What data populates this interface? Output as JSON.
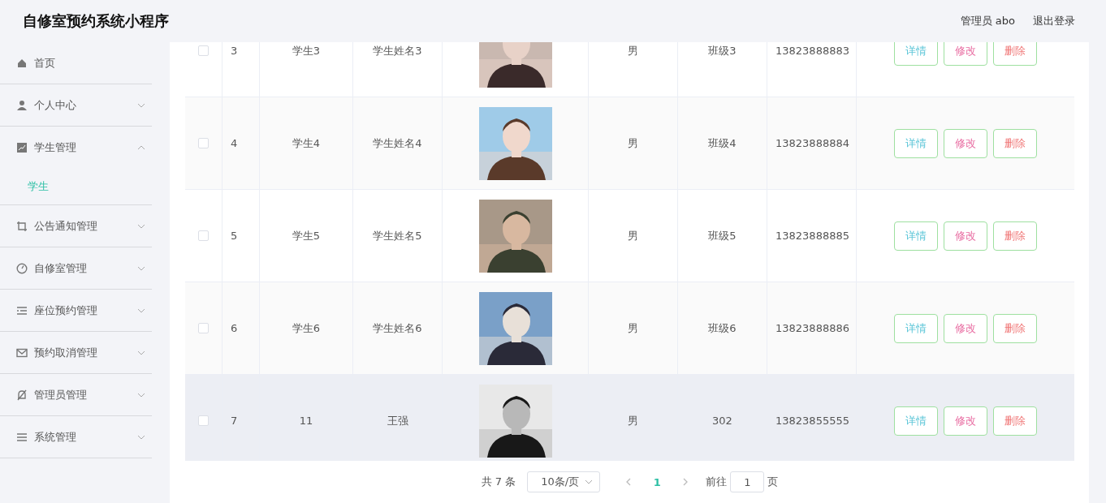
{
  "header": {
    "title": "自修室预约系统小程序",
    "user": "管理员 abo",
    "logout": "退出登录"
  },
  "sidebar": {
    "items": [
      {
        "label": "首页"
      },
      {
        "label": "个人中心",
        "expanded": false
      },
      {
        "label": "学生管理",
        "expanded": true,
        "children": [
          {
            "label": "学生",
            "selected": true
          }
        ]
      },
      {
        "label": "公告通知管理",
        "expanded": false
      },
      {
        "label": "自修室管理",
        "expanded": false
      },
      {
        "label": "座位预约管理",
        "expanded": false
      },
      {
        "label": "预约取消管理",
        "expanded": false
      },
      {
        "label": "管理员管理",
        "expanded": false
      },
      {
        "label": "系统管理",
        "expanded": false
      }
    ]
  },
  "table": {
    "rows": [
      {
        "index": "3",
        "student_no": "学生3",
        "name": "学生姓名3",
        "gender": "男",
        "class": "班级3",
        "phone": "13823888883",
        "checked": false,
        "highlighted": false,
        "actions": [
          "详情",
          "修改",
          "删除"
        ]
      },
      {
        "index": "4",
        "student_no": "学生4",
        "name": "学生姓名4",
        "gender": "男",
        "class": "班级4",
        "phone": "13823888884",
        "checked": false,
        "highlighted": false,
        "actions": [
          "详情",
          "修改",
          "删除"
        ]
      },
      {
        "index": "5",
        "student_no": "学生5",
        "name": "学生姓名5",
        "gender": "男",
        "class": "班级5",
        "phone": "13823888885",
        "checked": false,
        "highlighted": false,
        "actions": [
          "详情",
          "修改",
          "删除"
        ]
      },
      {
        "index": "6",
        "student_no": "学生6",
        "name": "学生姓名6",
        "gender": "男",
        "class": "班级6",
        "phone": "13823888886",
        "checked": false,
        "highlighted": false,
        "actions": [
          "详情",
          "修改",
          "删除"
        ]
      },
      {
        "index": "7",
        "student_no": "11",
        "name": "王强",
        "gender": "男",
        "class": "302",
        "phone": "13823855555",
        "checked": false,
        "highlighted": true,
        "actions": [
          "详情",
          "修改",
          "删除"
        ]
      }
    ]
  },
  "pagination": {
    "total": "共 7 条",
    "page_size": "10条/页",
    "pages": [
      {
        "label": "1",
        "selected": true
      }
    ],
    "goto_label": "前往",
    "goto_value": "1",
    "page_unit": "页"
  }
}
